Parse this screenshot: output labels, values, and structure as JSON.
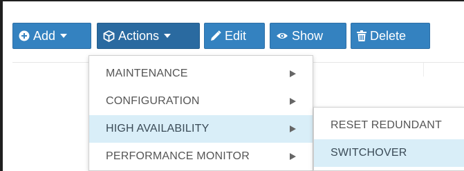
{
  "toolbar": {
    "add_label": "Add",
    "actions_label": "Actions",
    "edit_label": "Edit",
    "show_label": "Show",
    "delete_label": "Delete"
  },
  "actions_menu": {
    "items": [
      {
        "label": "MAINTENANCE",
        "has_submenu": true
      },
      {
        "label": "CONFIGURATION",
        "has_submenu": true
      },
      {
        "label": "HIGH AVAILABILITY",
        "has_submenu": true,
        "highlighted": true
      },
      {
        "label": "PERFORMANCE MONITOR",
        "has_submenu": true
      }
    ]
  },
  "high_availability_submenu": {
    "items": [
      {
        "label": "RESET REDUNDANT"
      },
      {
        "label": "SWITCHOVER",
        "highlighted": true
      }
    ]
  },
  "colors": {
    "button_bg": "#3482c0",
    "menu_highlight": "#d9eef8"
  },
  "icons": {
    "add": "plus-circle-icon",
    "actions": "cube-icon",
    "edit": "pencil-icon",
    "show": "eye-icon",
    "delete": "trash-icon"
  }
}
